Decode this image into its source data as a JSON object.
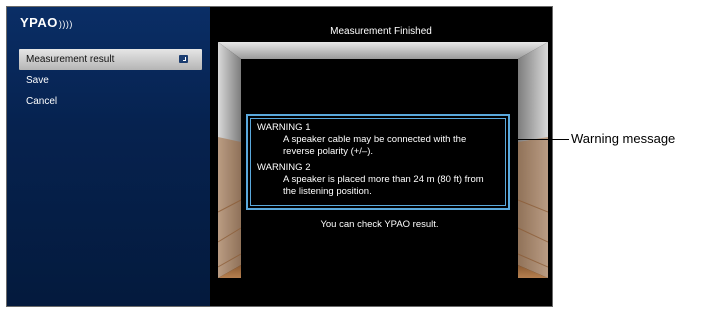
{
  "app": {
    "logo_text": "YPAO",
    "logo_waves": "))))"
  },
  "sidebar": {
    "items": [
      {
        "label": "Measurement result",
        "selected": true,
        "icon": "enter-icon"
      },
      {
        "label": "Save",
        "selected": false
      },
      {
        "label": "Cancel",
        "selected": false
      }
    ]
  },
  "main": {
    "title": "Measurement Finished",
    "warnings": [
      {
        "title": "WARNING 1",
        "text": "A speaker cable may be connected with the reverse polarity (+/–)."
      },
      {
        "title": "WARNING 2",
        "text": "A speaker is placed more than 24 m (80 ft) from the listening position."
      }
    ],
    "footer_note": "You can check YPAO result."
  },
  "callout": {
    "label": "Warning message"
  },
  "colors": {
    "sidebar": "#0a2e66",
    "highlight": "#5aa8dc",
    "background": "#000000"
  }
}
